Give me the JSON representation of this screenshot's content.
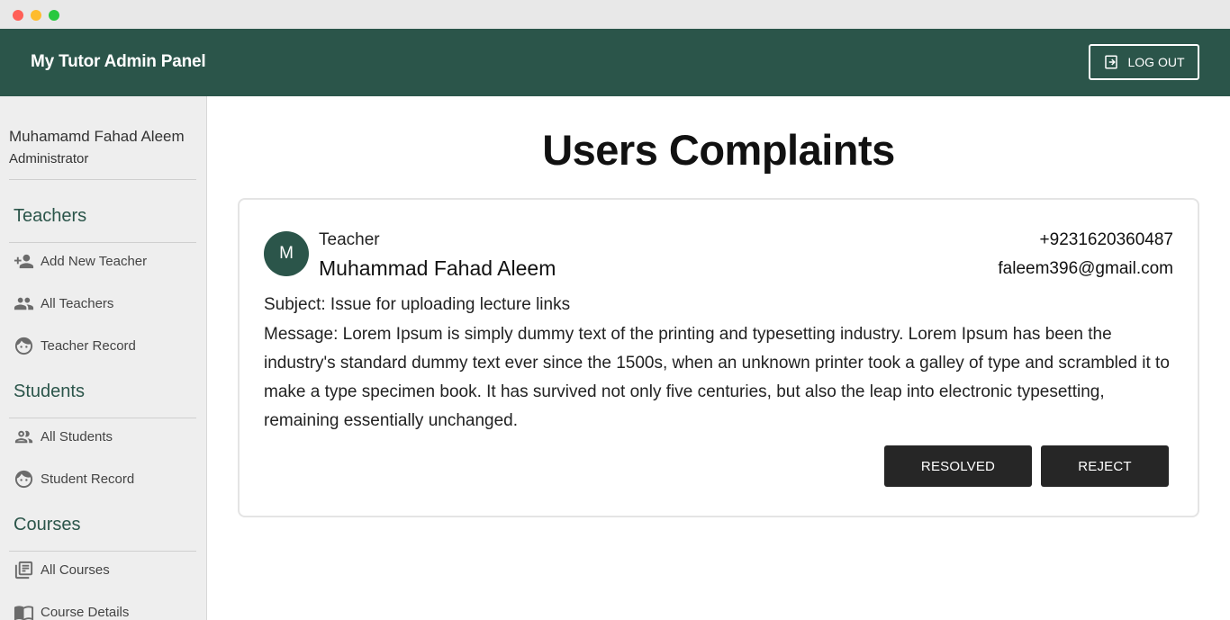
{
  "app": {
    "title": "My Tutor Admin Panel",
    "logout_label": "LOG OUT",
    "brand_color": "#2b554a"
  },
  "sidebar": {
    "user_name": "Muhamamd Fahad Aleem",
    "user_role": "Administrator",
    "sections": [
      {
        "title": "Teachers",
        "items": [
          {
            "label": "Add New Teacher",
            "icon": "person-add-icon"
          },
          {
            "label": "All Teachers",
            "icon": "people-icon"
          },
          {
            "label": "Teacher Record",
            "icon": "face-icon"
          }
        ]
      },
      {
        "title": "Students",
        "items": [
          {
            "label": "All Students",
            "icon": "people-outline-icon"
          },
          {
            "label": "Student Record",
            "icon": "face-icon"
          }
        ]
      },
      {
        "title": "Courses",
        "items": [
          {
            "label": "All Courses",
            "icon": "library-books-icon"
          },
          {
            "label": "Course Details",
            "icon": "book-icon"
          }
        ]
      }
    ]
  },
  "main": {
    "title": "Users Complaints",
    "complaint": {
      "avatar_initial": "M",
      "role": "Teacher",
      "name": "Muhammad Fahad Aleem",
      "phone": "+9231620360487",
      "email": "faleem396@gmail.com",
      "subject": "Subject: Issue for uploading lecture links",
      "message": "Message: Lorem Ipsum is simply dummy text of the printing and typesetting industry. Lorem Ipsum has been the industry's standard dummy text ever since the 1500s, when an unknown printer took a galley of type and scrambled it to make a type specimen book. It has survived not only five centuries, but also the leap into electronic typesetting, remaining essentially unchanged.",
      "resolved_label": "RESOLVED",
      "reject_label": "REJECT"
    }
  }
}
